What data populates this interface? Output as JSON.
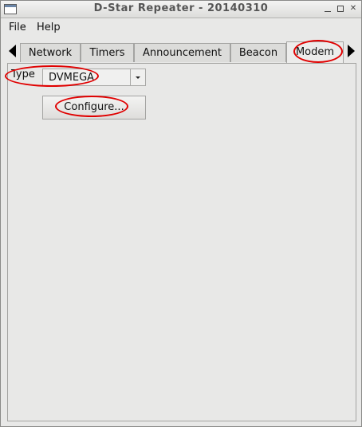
{
  "window": {
    "title": "D-Star Repeater - 20140310",
    "close_glyph": "✕"
  },
  "menu": {
    "items": [
      "File",
      "Help"
    ]
  },
  "tabs": [
    "Network",
    "Timers",
    "Announcement",
    "Beacon",
    "Modem"
  ],
  "active_tab": "Modem",
  "modem": {
    "type_label": "Type",
    "type_value": "DVMEGA",
    "configure_label": "Configure..."
  },
  "annotation_color": "#e00000"
}
